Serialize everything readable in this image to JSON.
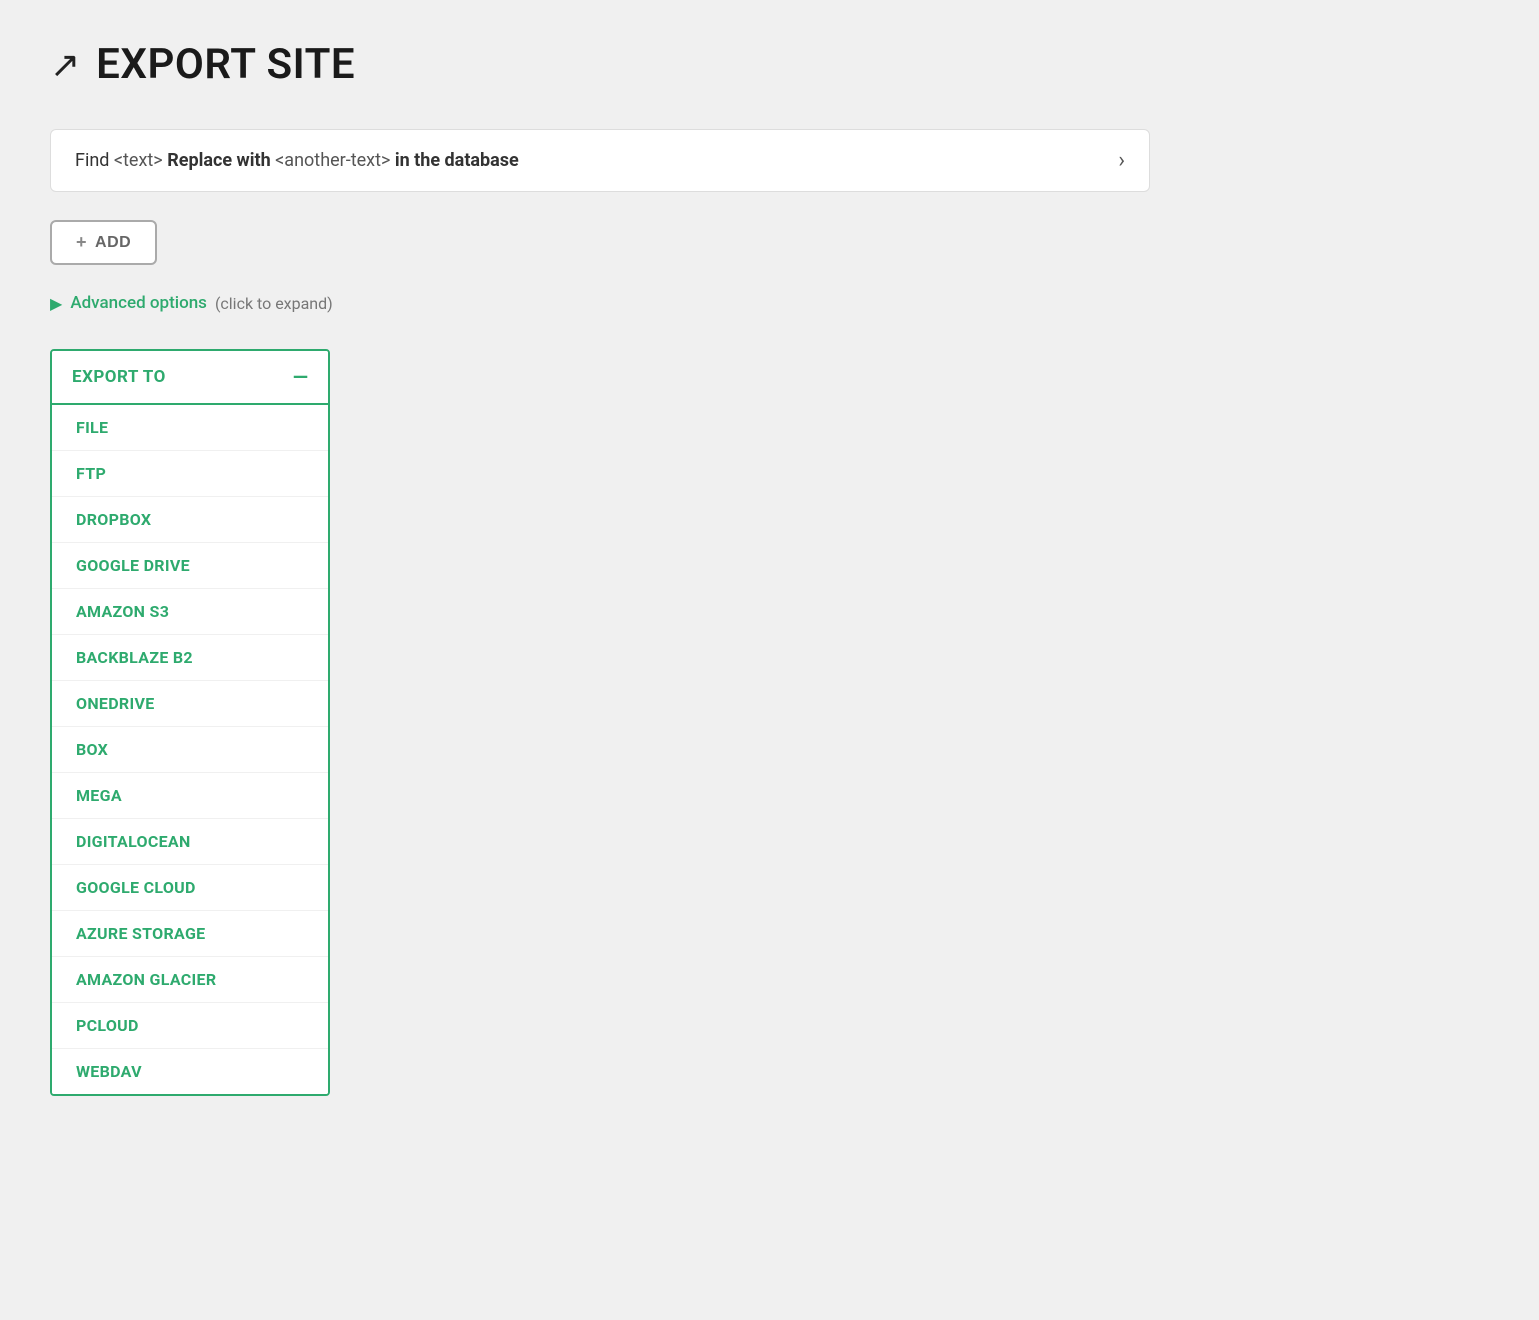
{
  "page": {
    "title": "EXPORT SITE",
    "icon": "export-icon"
  },
  "find_replace": {
    "text_find": "Find",
    "code_find": "<text>",
    "text_replace": "Replace with",
    "code_replace": "<another-text>",
    "text_suffix": "in the database"
  },
  "add_button": {
    "label": "ADD",
    "plus": "+"
  },
  "advanced_options": {
    "arrow": "▶",
    "label": "Advanced options",
    "hint": "(click to expand)"
  },
  "export_to": {
    "title": "EXPORT TO",
    "collapse": "—",
    "items": [
      {
        "label": "FILE"
      },
      {
        "label": "FTP"
      },
      {
        "label": "DROPBOX"
      },
      {
        "label": "GOOGLE DRIVE"
      },
      {
        "label": "AMAZON S3"
      },
      {
        "label": "BACKBLAZE B2"
      },
      {
        "label": "ONEDRIVE"
      },
      {
        "label": "BOX"
      },
      {
        "label": "MEGA"
      },
      {
        "label": "DIGITALOCEAN"
      },
      {
        "label": "GOOGLE CLOUD"
      },
      {
        "label": "AZURE STORAGE"
      },
      {
        "label": "AMAZON GLACIER"
      },
      {
        "label": "PCLOUD"
      },
      {
        "label": "WEBDAV"
      }
    ]
  }
}
